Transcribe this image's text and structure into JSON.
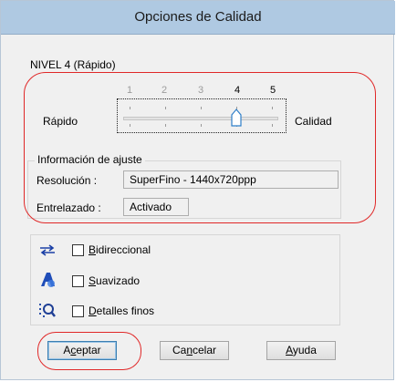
{
  "window": {
    "title": "Opciones de Calidad"
  },
  "level": {
    "label": "NIVEL 4 (Rápido)"
  },
  "slider": {
    "ticks": [
      "1",
      "2",
      "3",
      "4",
      "5"
    ],
    "selected_tick": "4",
    "left_label": "Rápido",
    "right_label": "Calidad",
    "value": 4,
    "min": 1,
    "max": 5
  },
  "info": {
    "title": "Información de ajuste",
    "resolution_label": "Resolución :",
    "resolution_value": "SuperFino - 1440x720ppp",
    "interlace_label": "Entrelazado :",
    "interlace_value": "Activado"
  },
  "options": [
    {
      "first": "B",
      "rest": "idireccional",
      "checked": false,
      "icon": "bidirectional-icon"
    },
    {
      "first": "S",
      "rest": "uavizado",
      "checked": false,
      "icon": "smoothing-icon"
    },
    {
      "first": "D",
      "rest": "etalles finos",
      "checked": false,
      "icon": "fine-detail-icon"
    }
  ],
  "buttons": {
    "accept_pre": "A",
    "accept_key": "c",
    "accept_post": "eptar",
    "cancel_pre": "Ca",
    "cancel_key": "n",
    "cancel_post": "celar",
    "help_pre": "",
    "help_key": "A",
    "help_post": "yuda"
  },
  "colors": {
    "titlebar": "#afc9e2",
    "annotation": "#e02828",
    "background": "#f0f0f0"
  }
}
